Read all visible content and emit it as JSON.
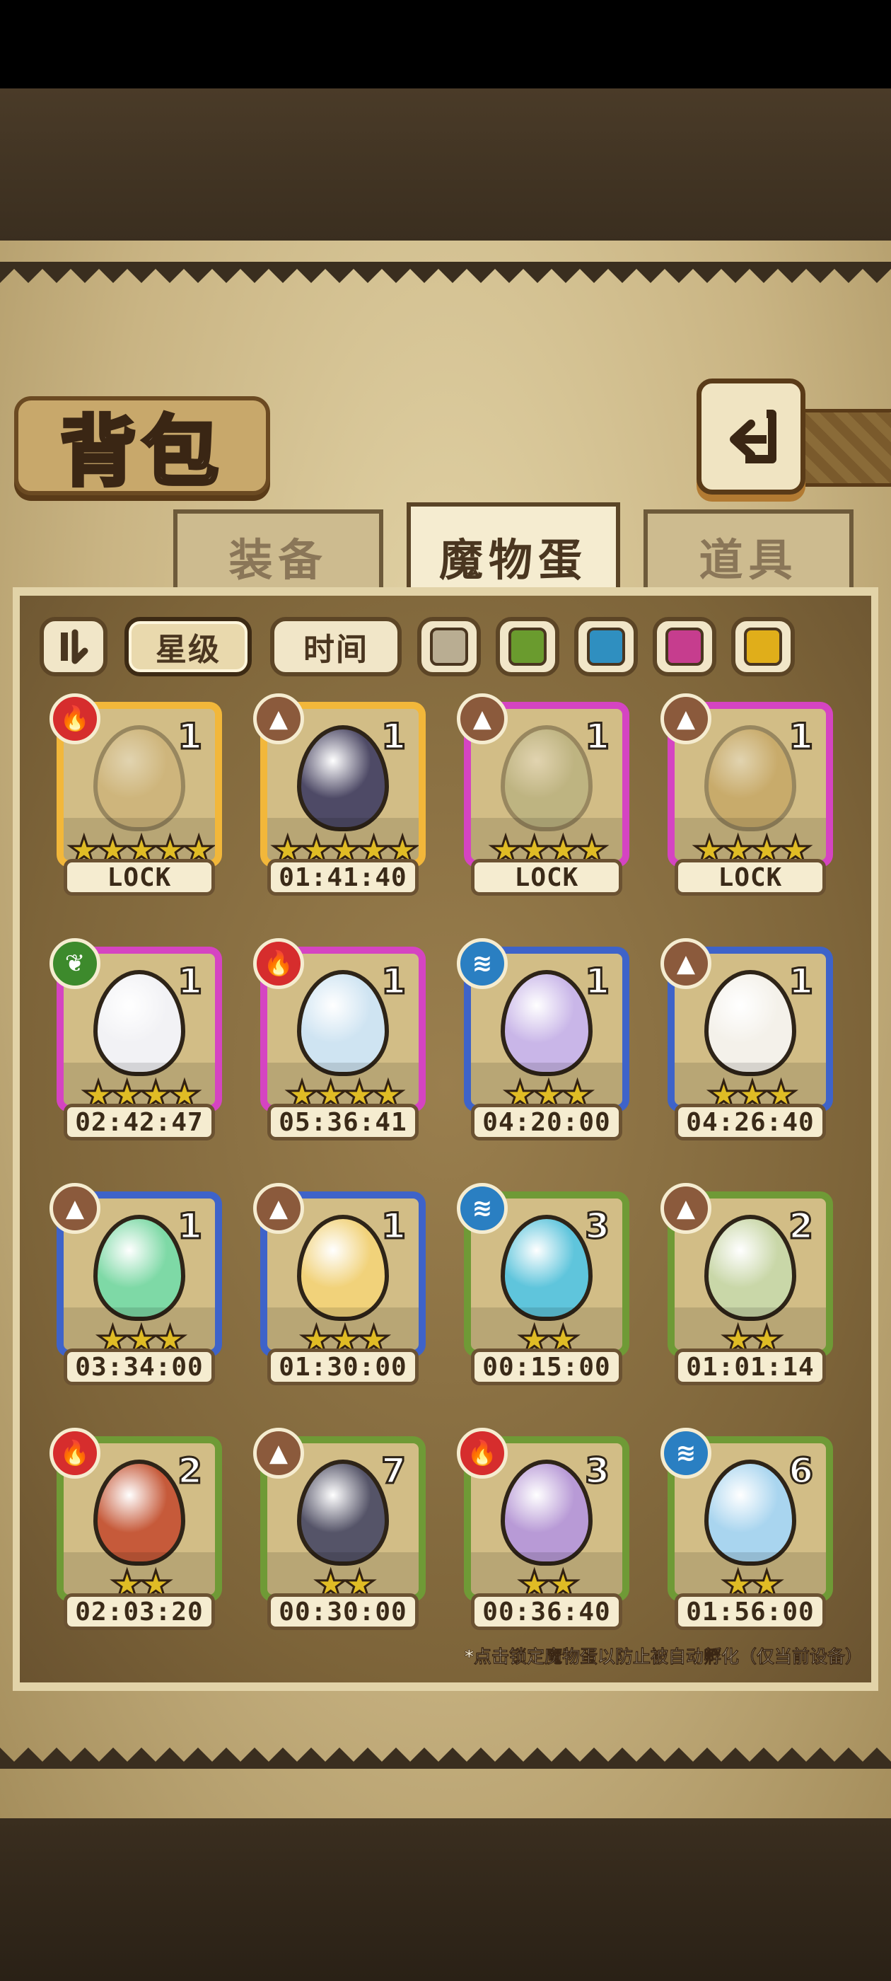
{
  "title": "背包",
  "tabs": [
    {
      "label": "装备",
      "active": false
    },
    {
      "label": "魔物蛋",
      "active": true
    },
    {
      "label": "道具",
      "active": false
    }
  ],
  "filters": {
    "star_label": "星级",
    "time_label": "时间",
    "colors": [
      "#b9ad92",
      "#6a9b2e",
      "#2f8fc0",
      "#c63d8e",
      "#e0ae1a"
    ]
  },
  "footnote": "*点击锁定魔物蛋以防止被自动孵化（仅当前设备）",
  "element_colors": {
    "fire": "#d62d2d",
    "earth": "#8b5a3c",
    "water": "#2a7fc2",
    "nature": "#3d8a2c"
  },
  "rarity_colors": {
    "gold": "#f2b73a",
    "purple": "#d544c2",
    "blue": "#3e63c9",
    "green": "#6f9a36"
  },
  "eggs": [
    {
      "element": "fire",
      "count": "1",
      "stars": 5,
      "rarity": "gold",
      "label": "LOCK",
      "locked": true,
      "egg_color": "#c9a86a"
    },
    {
      "element": "earth",
      "count": "1",
      "stars": 5,
      "rarity": "gold",
      "label": "01:41:40",
      "locked": false,
      "egg_color": "#4e4a66"
    },
    {
      "element": "earth",
      "count": "1",
      "stars": 4,
      "rarity": "purple",
      "label": "LOCK",
      "locked": true,
      "egg_color": "#9ba47a"
    },
    {
      "element": "earth",
      "count": "1",
      "stars": 4,
      "rarity": "purple",
      "label": "LOCK",
      "locked": true,
      "egg_color": "#b88b3a"
    },
    {
      "element": "nature",
      "count": "1",
      "stars": 4,
      "rarity": "purple",
      "label": "02:42:47",
      "locked": false,
      "egg_color": "#f2f2f5"
    },
    {
      "element": "fire",
      "count": "1",
      "stars": 4,
      "rarity": "purple",
      "label": "05:36:41",
      "locked": false,
      "egg_color": "#cfe4f2"
    },
    {
      "element": "water",
      "count": "1",
      "stars": 3,
      "rarity": "blue",
      "label": "04:20:00",
      "locked": false,
      "egg_color": "#c9b6e8"
    },
    {
      "element": "earth",
      "count": "1",
      "stars": 3,
      "rarity": "blue",
      "label": "04:26:40",
      "locked": false,
      "egg_color": "#f4f1ea"
    },
    {
      "element": "earth",
      "count": "1",
      "stars": 3,
      "rarity": "blue",
      "label": "03:34:00",
      "locked": false,
      "egg_color": "#7ed9a6"
    },
    {
      "element": "earth",
      "count": "1",
      "stars": 3,
      "rarity": "blue",
      "label": "01:30:00",
      "locked": false,
      "egg_color": "#f1d27a"
    },
    {
      "element": "water",
      "count": "3",
      "stars": 2,
      "rarity": "green",
      "label": "00:15:00",
      "locked": false,
      "egg_color": "#5fc5dc"
    },
    {
      "element": "earth",
      "count": "2",
      "stars": 2,
      "rarity": "green",
      "label": "01:01:14",
      "locked": false,
      "egg_color": "#c9d7a8"
    },
    {
      "element": "fire",
      "count": "2",
      "stars": 2,
      "rarity": "green",
      "label": "02:03:20",
      "locked": false,
      "egg_color": "#c65a3a"
    },
    {
      "element": "earth",
      "count": "7",
      "stars": 2,
      "rarity": "green",
      "label": "00:30:00",
      "locked": false,
      "egg_color": "#555468"
    },
    {
      "element": "fire",
      "count": "3",
      "stars": 2,
      "rarity": "green",
      "label": "00:36:40",
      "locked": false,
      "egg_color": "#b89ad6"
    },
    {
      "element": "water",
      "count": "6",
      "stars": 2,
      "rarity": "green",
      "label": "01:56:00",
      "locked": false,
      "egg_color": "#a9d5ef"
    }
  ]
}
